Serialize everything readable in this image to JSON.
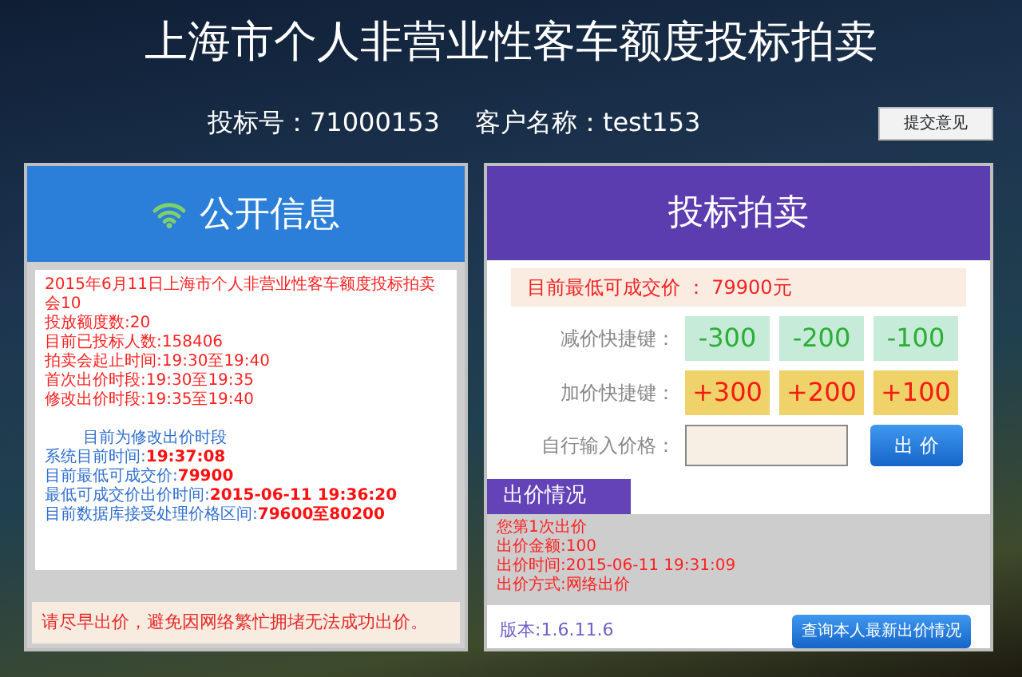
{
  "title": "上海市个人非营业性客车额度投标拍卖",
  "bidder": {
    "bid_number": "投标号：71000153",
    "customer": "客户名称：test153"
  },
  "feedback_button": "提交意见",
  "public_info": {
    "header": "公开信息",
    "lines": [
      "2015年6月11日上海市个人非营业性客车额度投标拍卖会10",
      "投放额度数:20",
      "目前已投标人数:158406",
      "拍卖会起止时间:19:30至19:40",
      "首次出价时段:19:30至19:35",
      "修改出价时段:19:35至19:40"
    ],
    "phase": "目前为修改出价时段",
    "status": [
      {
        "label": "系统目前时间:",
        "value": "19:37:08"
      },
      {
        "label": "目前最低可成交价:",
        "value": "79900"
      },
      {
        "label": "最低可成交价出价时间:",
        "value": "2015-06-11 19:36:20"
      },
      {
        "label": "目前数据库接受处理价格区间:",
        "value": "79600至80200"
      }
    ],
    "notice": "请尽早出价，避免因网络繁忙拥堵无法成功出价。"
  },
  "auction": {
    "header": "投标拍卖",
    "lowest_price": "目前最低可成交价 ： 79900元",
    "quick_rows": [
      {
        "kind": "decrease",
        "label": "减价快捷键：",
        "buttons": [
          "-300",
          "-200",
          "-100"
        ]
      },
      {
        "kind": "increase",
        "label": "加价快捷键：",
        "buttons": [
          "+300",
          "+200",
          "+100"
        ]
      }
    ],
    "manual_label": "自行输入价格：",
    "submit_button": "出 价",
    "bid_status": {
      "tab": "出价情况",
      "lines": [
        "您第1次出价",
        "出价金额:100",
        "出价时间:2015-06-11 19:31:09",
        "出价方式:网络出价"
      ]
    },
    "version": "版本:1.6.11.6",
    "query_button": "查询本人最新出价情况"
  }
}
